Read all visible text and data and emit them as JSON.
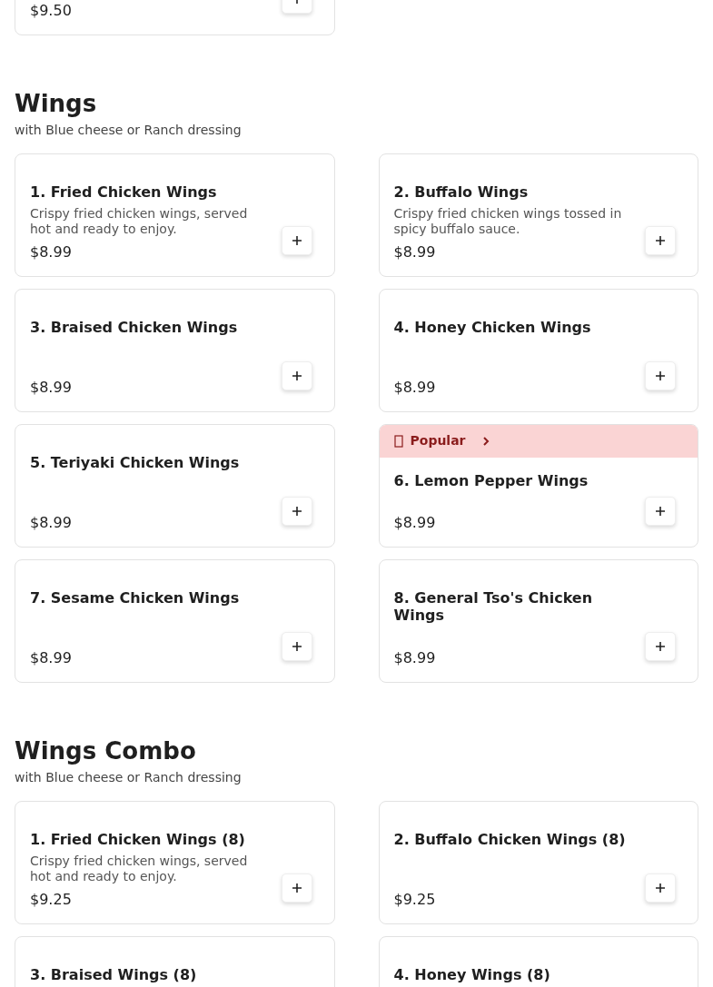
{
  "sections": [
    {
      "rows": [
        {
          "items": [
            {
              "price": "$9.50"
            }
          ]
        }
      ]
    },
    {
      "title": "Wings",
      "subtitle": "with Blue cheese or Ranch dressing",
      "rows": [
        {
          "items": [
            {
              "name": "1. Fried Chicken Wings",
              "description": "Crispy fried chicken wings, served hot and ready to enjoy.",
              "price": "$8.99"
            },
            {
              "name": "2. Buffalo Wings",
              "description": "Crispy fried chicken wings tossed in spicy buffalo sauce.",
              "price": "$8.99"
            }
          ]
        },
        {
          "items": [
            {
              "name": "3. Braised Chicken Wings",
              "price": "$8.99"
            },
            {
              "name": "4. Honey Chicken Wings",
              "price": "$8.99"
            }
          ]
        },
        {
          "items": [
            {
              "name": "5. Teriyaki Chicken Wings",
              "price": "$8.99"
            },
            {
              "badge": "Popular",
              "name": "6. Lemon Pepper Wings",
              "price": "$8.99"
            }
          ]
        },
        {
          "items": [
            {
              "name": "7. Sesame Chicken Wings",
              "price": "$8.99"
            },
            {
              "name": "8. General Tso's Chicken Wings",
              "price": "$8.99"
            }
          ]
        }
      ]
    },
    {
      "title": "Wings Combo",
      "subtitle": "with Blue cheese or Ranch dressing",
      "rows": [
        {
          "items": [
            {
              "name": "1. Fried Chicken Wings (8)",
              "description": "Crispy fried chicken wings, served hot and ready to enjoy.",
              "price": "$9.25"
            },
            {
              "name": "2. Buffalo Chicken Wings (8)",
              "price": "$9.25"
            }
          ]
        },
        {
          "items": [
            {
              "name": "3. Braised Wings (8)"
            },
            {
              "name": "4. Honey Wings (8)"
            }
          ]
        }
      ]
    }
  ]
}
